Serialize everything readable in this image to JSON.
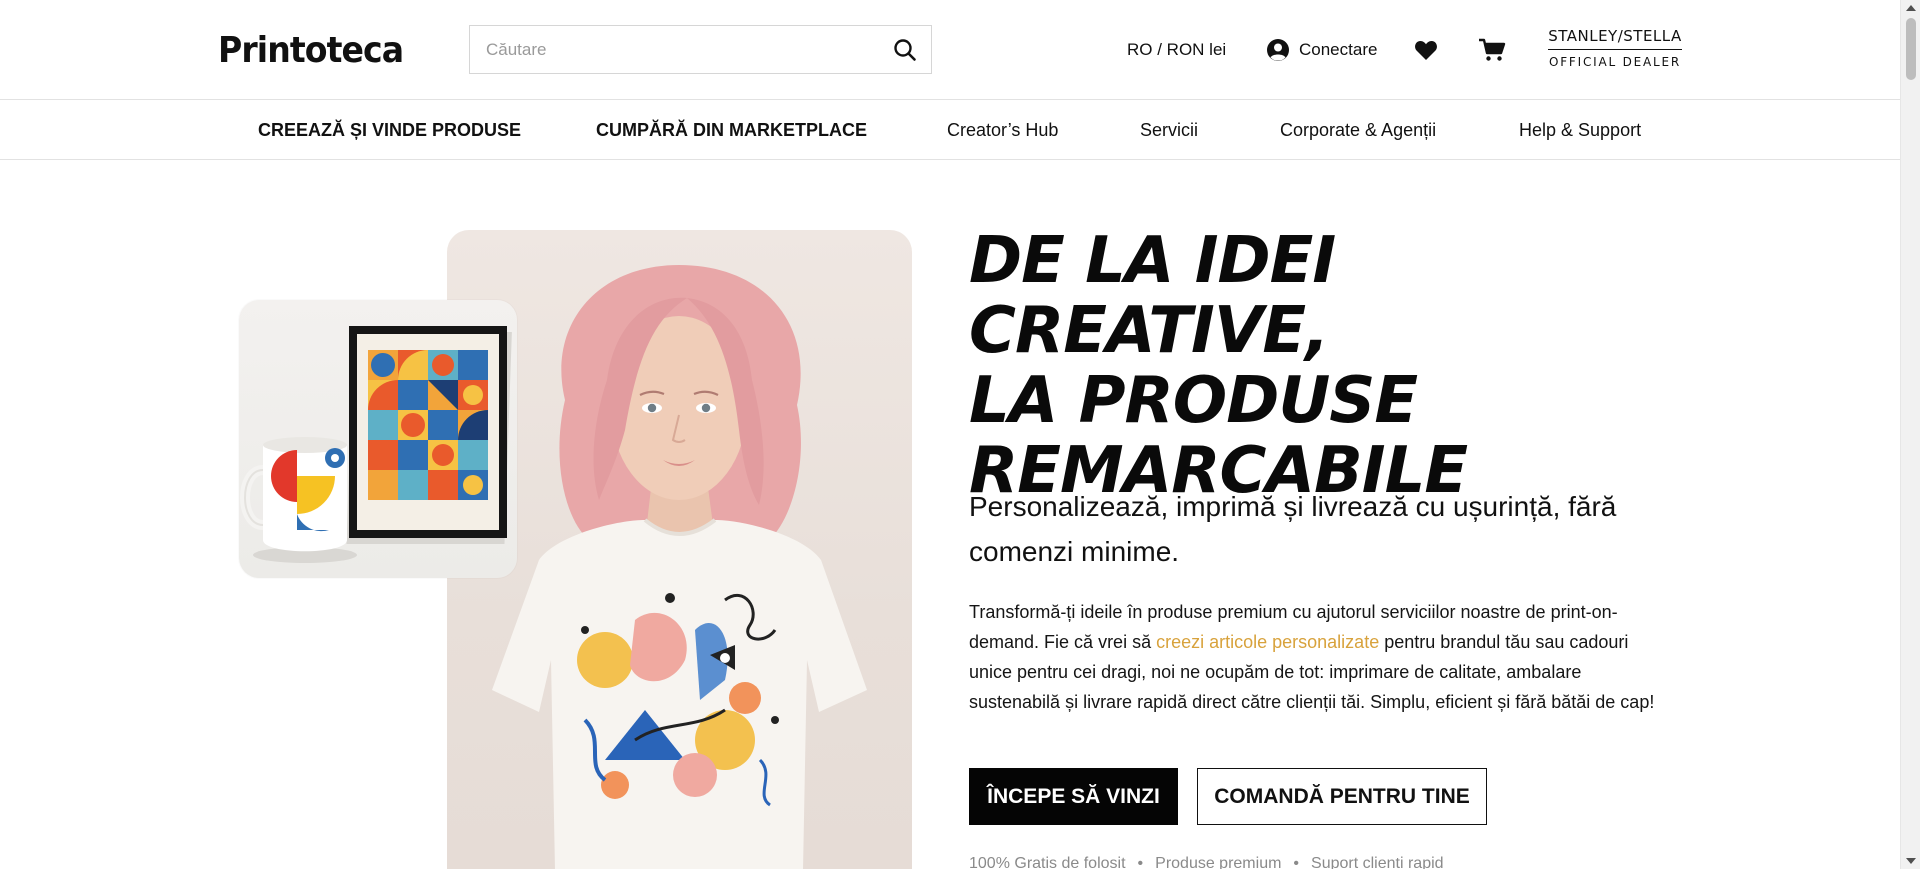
{
  "header": {
    "logo": "Printoteca",
    "search": {
      "placeholder": "Căutare"
    },
    "locale": "RO / RON lei",
    "login_label": "Conectare",
    "dealer": {
      "brand": "STANLEY/STELLA",
      "tag": "OFFICIAL DEALER"
    }
  },
  "nav": {
    "items": [
      {
        "label": "CREEAZĂ ȘI VINDE PRODUSE"
      },
      {
        "label": "CUMPĂRĂ DIN MARKETPLACE"
      },
      {
        "label": "Creator’s Hub"
      },
      {
        "label": "Servicii"
      },
      {
        "label": "Corporate & Agenții"
      },
      {
        "label": "Help & Support"
      }
    ]
  },
  "hero": {
    "title_lines": [
      "DE LA IDEI CREATIVE,",
      "LA PRODUSE",
      "REMARCABILE"
    ],
    "subtitle": "Personalizează, imprimă și livrează cu ușurință, fără comenzi minime.",
    "body_before": "Transformă-ți ideile în produse premium cu ajutorul serviciilor noastre de print-on-demand. Fie că vrei să ",
    "body_link": "creezi articole personalizate",
    "body_after": " pentru brandul tău sau cadouri unice pentru cei dragi, noi ne ocupăm de tot: imprimare de calitate, ambalare sustenabilă și livrare rapidă direct către clienții tăi. Simplu, eficient și fără bătăi de cap!",
    "primary_cta": "ÎNCEPE SĂ VINZI",
    "secondary_cta": "COMANDĂ PENTRU TINE",
    "perks": [
      "100% Gratis de folosit",
      "Produse premium",
      "Suport clienți rapid"
    ],
    "perk_separator": "•"
  },
  "colors": {
    "accent_link": "#d8a23c",
    "primary_button": "#050505",
    "hair": "#e8a7a8"
  },
  "icons": {
    "search": "search-icon",
    "account": "user-circle-icon",
    "wishlist": "heart-icon",
    "cart": "cart-icon"
  }
}
